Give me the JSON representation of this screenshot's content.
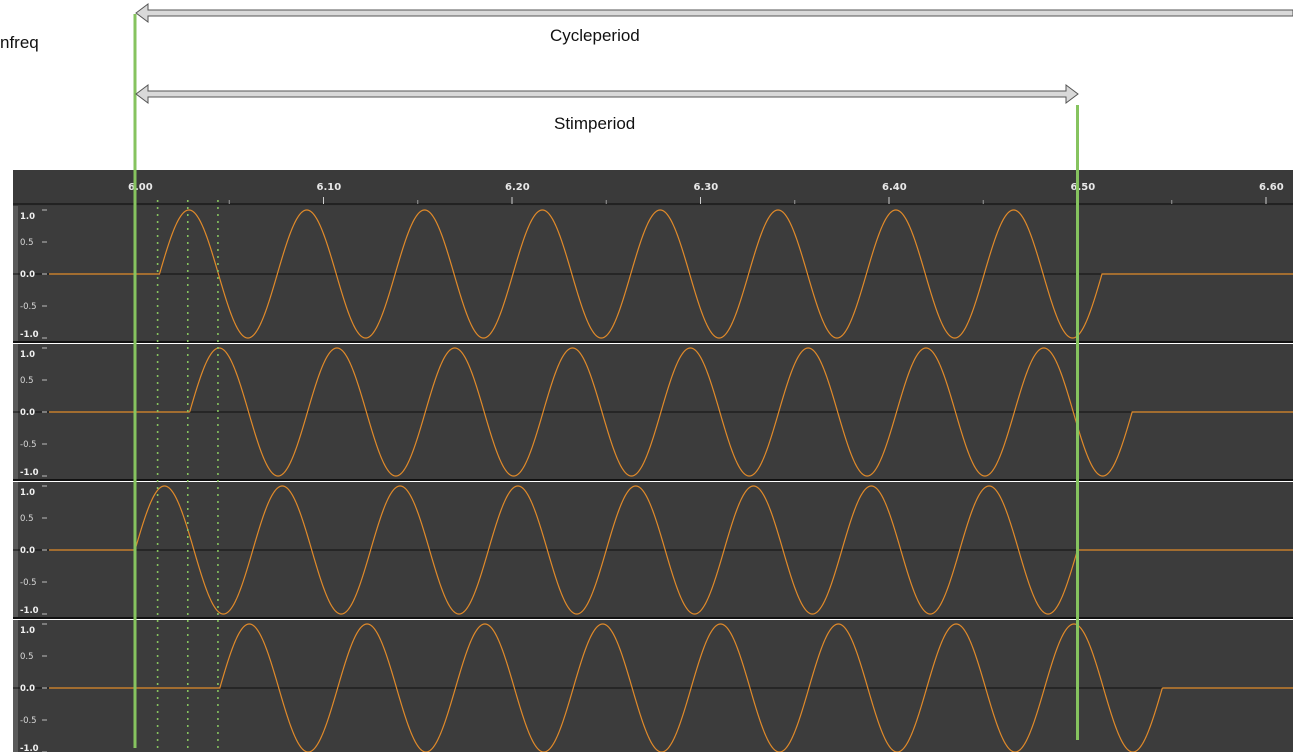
{
  "annotations": {
    "side_label": "nfreq",
    "cycle_label": "Cycleperiod",
    "stim_label": "Stimperiod"
  },
  "colors": {
    "waveform": "#e08a2a",
    "panel_bg": "#3c3c3c",
    "ruler_bg": "#3a3a3a",
    "marker": "#86c35f",
    "dotted_marker": "#86c35f",
    "arrow_fill": "#d9d9d9",
    "arrow_stroke": "#555555"
  },
  "chart_data": {
    "type": "line",
    "title": "",
    "xlabel": "",
    "ylabel": "",
    "x_ticks": [
      "6.00",
      "6.10",
      "6.20",
      "6.30",
      "6.40",
      "6.50",
      "6.60"
    ],
    "xlim": [
      5.993,
      6.611
    ],
    "y_ticks": [
      "1.0",
      "0.5",
      "0.0",
      "-0.5",
      "-1.0"
    ],
    "ylim": [
      -1.0,
      1.0
    ],
    "grid": false,
    "markers": {
      "cycle_start": 6.0,
      "stim_end": 6.5,
      "dotted": [
        6.012,
        6.028,
        6.044
      ]
    },
    "series": [
      {
        "track": 1,
        "signal": "sine",
        "amplitude": 1.0,
        "frequency_hz": 16,
        "start": 6.013,
        "end": 6.513
      },
      {
        "track": 2,
        "signal": "sine",
        "amplitude": 1.0,
        "frequency_hz": 16,
        "start": 6.029,
        "end": 6.529
      },
      {
        "track": 3,
        "signal": "sine",
        "amplitude": 1.0,
        "frequency_hz": 16,
        "start": 6.0,
        "end": 6.5
      },
      {
        "track": 4,
        "signal": "sine",
        "amplitude": 1.0,
        "frequency_hz": 16,
        "start": 6.045,
        "end": 6.545
      }
    ]
  }
}
